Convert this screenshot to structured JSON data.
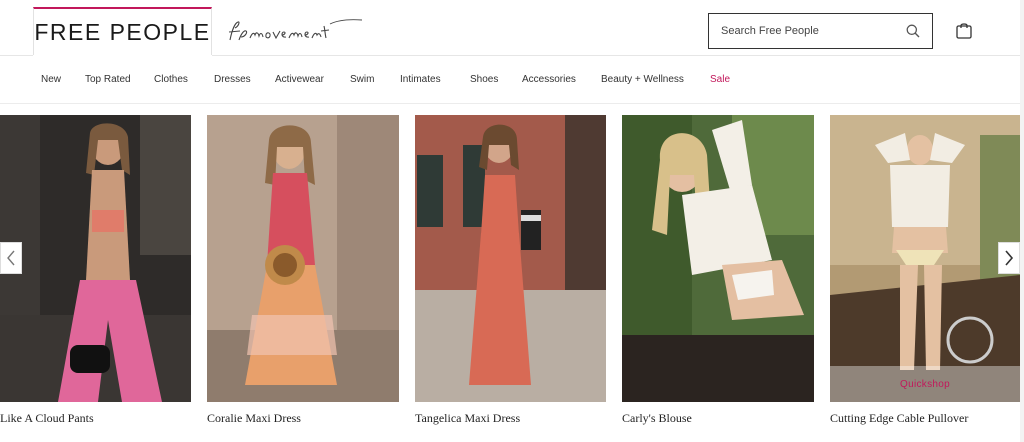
{
  "header": {
    "brand": "FREE PEOPLE",
    "movement_logo_text": "fp movement",
    "search_placeholder": "Search Free People"
  },
  "nav": {
    "items": [
      {
        "label": "New"
      },
      {
        "label": "Top Rated"
      },
      {
        "label": "Clothes"
      },
      {
        "label": "Dresses"
      },
      {
        "label": "Activewear"
      },
      {
        "label": "Swim"
      },
      {
        "label": "Intimates"
      },
      {
        "label": "Shoes"
      },
      {
        "label": "Accessories"
      },
      {
        "label": "Beauty + Wellness"
      },
      {
        "label": "Sale",
        "color": "#c2185b"
      }
    ]
  },
  "carousel": {
    "products": [
      {
        "name": "Like A Cloud Pants",
        "image": "woman in pink wide-leg pants and striped bandeau top"
      },
      {
        "name": "Coralie Maxi Dress",
        "image": "woman in floral tiered maxi dress with straw bag"
      },
      {
        "name": "Tangelica Maxi Dress",
        "image": "woman in coral strapless maxi dress by brick wall"
      },
      {
        "name": "Carly's Blouse",
        "image": "woman in white sheer blouse and white bikini bottoms"
      },
      {
        "name": "Cutting Edge Cable Pullover",
        "image": "woman in cropped white cable sweater on a boat"
      }
    ],
    "quickshop_label": "Quickshop",
    "prev_icon": "chevron-left-icon",
    "next_icon": "chevron-right-icon"
  },
  "colors": {
    "accent": "#c2185b",
    "text": "#222222"
  }
}
